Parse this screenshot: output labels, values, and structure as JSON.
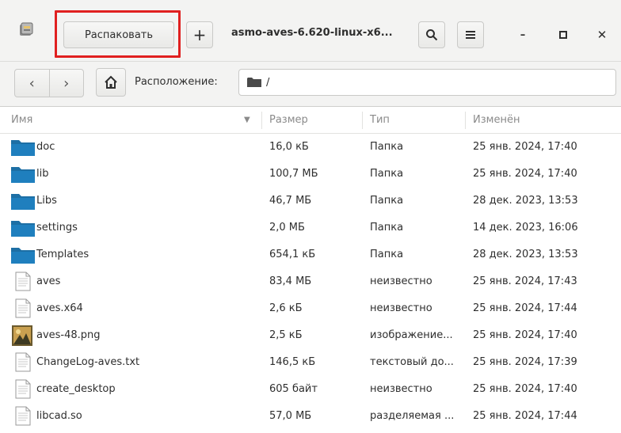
{
  "header": {
    "extract_label": "Распаковать",
    "add_label": "+",
    "title": "asmo-aves-6.620-linux-x6...",
    "minimize_label": "–",
    "maximize_label": "□",
    "close_label": "✕"
  },
  "location": {
    "back_label": "‹",
    "forward_label": "›",
    "label": "Расположение:",
    "path": "/"
  },
  "columns": {
    "name": "Имя",
    "size": "Размер",
    "type": "Тип",
    "modified": "Изменён"
  },
  "files": [
    {
      "name": "doc",
      "size": "16,0 кБ",
      "type": "Папка",
      "modified": "25 янв. 2024, 17:40",
      "icon": "folder-icon"
    },
    {
      "name": "lib",
      "size": "100,7 МБ",
      "type": "Папка",
      "modified": "25 янв. 2024, 17:40",
      "icon": "folder-icon"
    },
    {
      "name": "Libs",
      "size": "46,7 МБ",
      "type": "Папка",
      "modified": "28 дек. 2023, 13:53",
      "icon": "folder-icon"
    },
    {
      "name": "settings",
      "size": "2,0 МБ",
      "type": "Папка",
      "modified": "14 дек. 2023, 16:06",
      "icon": "folder-icon"
    },
    {
      "name": "Templates",
      "size": "654,1 кБ",
      "type": "Папка",
      "modified": "28 дек. 2023, 13:53",
      "icon": "folder-icon"
    },
    {
      "name": "aves",
      "size": "83,4 МБ",
      "type": "неизвестно",
      "modified": "25 янв. 2024, 17:43",
      "icon": "document-icon"
    },
    {
      "name": "aves.x64",
      "size": "2,6 кБ",
      "type": "неизвестно",
      "modified": "25 янв. 2024, 17:44",
      "icon": "document-icon"
    },
    {
      "name": "aves-48.png",
      "size": "2,5 кБ",
      "type": "изображение...",
      "modified": "25 янв. 2024, 17:40",
      "icon": "image-icon"
    },
    {
      "name": "ChangeLog-aves.txt",
      "size": "146,5 кБ",
      "type": "текстовый до...",
      "modified": "25 янв. 2024, 17:39",
      "icon": "document-icon"
    },
    {
      "name": "create_desktop",
      "size": "605 байт",
      "type": "неизвестно",
      "modified": "25 янв. 2024, 17:40",
      "icon": "document-icon"
    },
    {
      "name": "libcad.so",
      "size": "57,0 МБ",
      "type": "разделяемая ...",
      "modified": "25 янв. 2024, 17:44",
      "icon": "document-icon"
    }
  ],
  "colors": {
    "folder": "#1d6fa5",
    "highlight": "#e02020",
    "header_bg": "#f3f3f2"
  }
}
